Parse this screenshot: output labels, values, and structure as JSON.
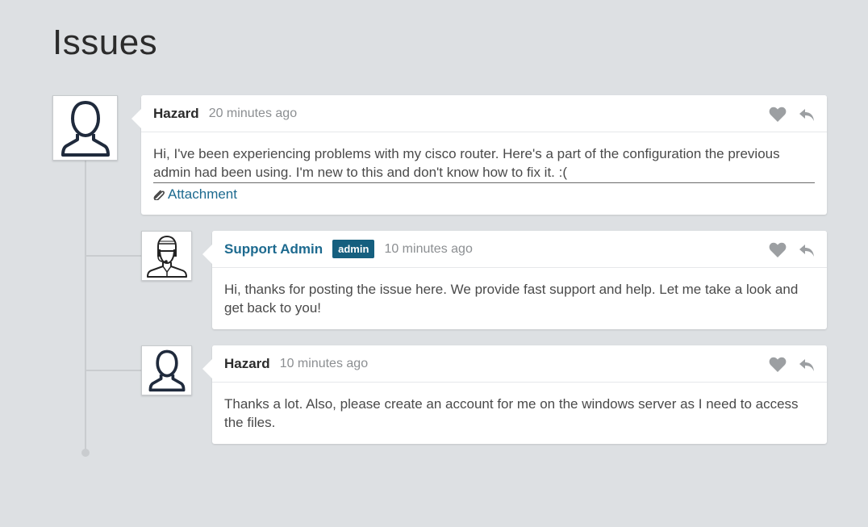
{
  "page": {
    "title": "Issues"
  },
  "colors": {
    "background": "#dde0e3",
    "accent": "#1d6a8f",
    "badge": "#155f7f",
    "thread_line": "#c9cccf"
  },
  "comments": [
    {
      "author": "Hazard",
      "time": "20 minutes ago",
      "avatar_icon": "user-icon",
      "body": "Hi, I've been experiencing problems with my cisco router. Here's a part of the configuration the previous admin had been using. I'm new to this and don't know how to fix it. :(",
      "attachment_label": "Attachment"
    },
    {
      "author": "Support Admin",
      "badge": "admin",
      "time": "10 minutes ago",
      "avatar_icon": "support-agent-icon",
      "body": "Hi, thanks for posting the issue here. We provide fast support and help. Let me take a look and get back to you!"
    },
    {
      "author": "Hazard",
      "time": "10 minutes ago",
      "avatar_icon": "user-icon",
      "body": "Thanks a lot. Also, please create an account for me on the windows server as I need to access the files."
    }
  ],
  "actions": {
    "like_icon": "heart-icon",
    "reply_icon": "reply-icon"
  }
}
